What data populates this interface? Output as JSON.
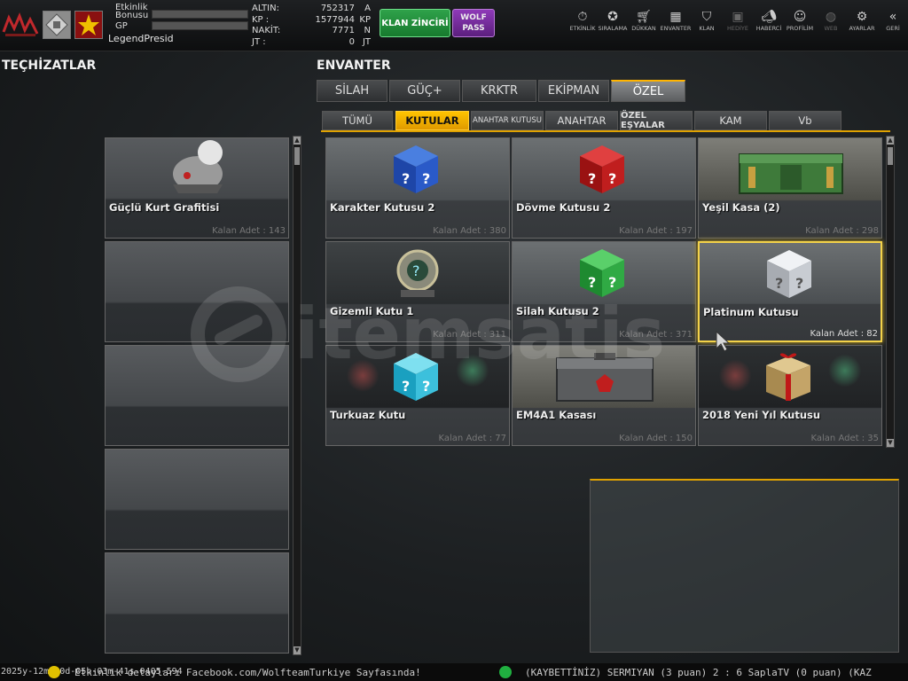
{
  "player": {
    "name": "LegendPresid",
    "labels": {
      "bonus_line1": "Etkinlik",
      "bonus_line2": "Bonusu",
      "gp": "GP"
    }
  },
  "currency": [
    {
      "label": "ALTIN:",
      "value": "752317",
      "unit": "A"
    },
    {
      "label": "KP  :",
      "value": "1577944",
      "unit": "KP"
    },
    {
      "label": "NAKİT:",
      "value": "7771",
      "unit": "N"
    },
    {
      "label": "JT  :",
      "value": "0",
      "unit": "JT"
    }
  ],
  "buttons": {
    "klan": "KLAN ZİNCİRİ",
    "wolf_line1": "WOLF",
    "wolf_line2": "PASS"
  },
  "nav": [
    {
      "label": "ETKİNLİK",
      "icon": "stopwatch-icon"
    },
    {
      "label": "SIRALAMA",
      "icon": "medal-icon"
    },
    {
      "label": "DÜKKAN",
      "icon": "cart-icon"
    },
    {
      "label": "ENVANTER",
      "icon": "inventory-icon"
    },
    {
      "label": "KLAN",
      "icon": "shield-icon"
    },
    {
      "label": "HEDİYE",
      "icon": "gift-icon"
    },
    {
      "label": "HABERCİ",
      "icon": "megaphone-icon"
    },
    {
      "label": "PROFİLİM",
      "icon": "profile-icon"
    },
    {
      "label": "WEB",
      "icon": "globe-icon"
    },
    {
      "label": "AYARLAR",
      "icon": "gear-icon"
    },
    {
      "label": "GERİ",
      "icon": "back-icon"
    }
  ],
  "left": {
    "title": "TEÇHİZATLAR",
    "slots": [
      {
        "title": "Güçlü Kurt Grafitisi",
        "qty": "Kalan Adet : 143"
      }
    ]
  },
  "inventory": {
    "title": "ENVANTER",
    "tabs": [
      "SİLAH",
      "GÜÇ+",
      "KRKTR",
      "EKİPMAN",
      "ÖZEL"
    ],
    "active_tab": "ÖZEL",
    "subtabs": [
      "TÜMÜ",
      "KUTULAR",
      "ANAHTAR KUTUSU",
      "ANAHTAR",
      "ÖZEL EŞYALAR",
      "KAM",
      "Vb"
    ],
    "active_subtab": "KUTULAR",
    "items": [
      {
        "title": "Karakter Kutusu 2",
        "qty": "Kalan Adet : 380",
        "icon": "blue-question-cube-icon"
      },
      {
        "title": "Dövme Kutusu 2",
        "qty": "Kalan Adet : 197",
        "icon": "red-question-cube-icon"
      },
      {
        "title": "Yeşil Kasa (2)",
        "qty": "Kalan Adet : 298",
        "icon": "green-crate-icon"
      },
      {
        "title": "Gizemli Kutu 1",
        "qty": "Kalan Adet : 311",
        "icon": "mystery-device-icon"
      },
      {
        "title": "Silah Kutusu 2",
        "qty": "Kalan Adet : 371",
        "icon": "green-question-cube-icon"
      },
      {
        "title": "Platinum Kutusu",
        "qty": "Kalan Adet : 82",
        "icon": "platinum-question-cube-icon"
      },
      {
        "title": "Turkuaz Kutu",
        "qty": "Kalan Adet : 77",
        "icon": "turquoise-question-cube-icon"
      },
      {
        "title": "EM4A1 Kasası",
        "qty": "Kalan Adet : 150",
        "icon": "metal-case-icon"
      },
      {
        "title": "2018 Yeni Yıl Kutusu",
        "qty": "Kalan Adet : 35",
        "icon": "gift-box-icon"
      }
    ],
    "selected_item": "Platinum Kutusu"
  },
  "watermark": "itemsatis",
  "colors": {
    "accent": "#e0a200",
    "selected_border": "#f3d24a",
    "klan_green": "#2fa24a",
    "wolf_purple": "#8e3ab8"
  },
  "bottom": {
    "timestamp": "2025y-12m-30d-05h-03m-41s-0405-594",
    "notice": "Etkinlik detayları Facebook.com/WolfteamTurkiye Sayfasında!",
    "killfeed": "(KAYBETTİNİZ) SERMIYAN (3 puan) 2 : 6 SaplaTV (0 puan) (KAZ"
  }
}
